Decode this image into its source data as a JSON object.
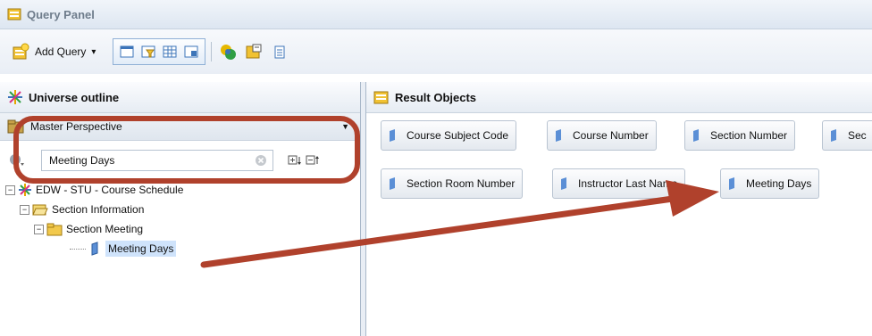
{
  "window": {
    "title": "Query Panel"
  },
  "toolbar": {
    "add_query_label": "Add Query",
    "add_query_arrow": "▾"
  },
  "universe_outline": {
    "title": "Universe outline",
    "perspective": "Master Perspective",
    "search_value": "Meeting Days",
    "tree": [
      {
        "label": "EDW - STU - Course Schedule",
        "icon": "universe-icon"
      },
      {
        "label": "Section Information",
        "icon": "folder-open-icon"
      },
      {
        "label": "Section Meeting",
        "icon": "folder-icon"
      },
      {
        "label": "Meeting Days",
        "icon": "dimension-icon"
      }
    ]
  },
  "result_objects": {
    "title": "Result Objects",
    "items": [
      {
        "label": "Course Subject Code"
      },
      {
        "label": "Course Number"
      },
      {
        "label": "Section Number"
      },
      {
        "label": "Sec"
      },
      {
        "label": "Section Room Number"
      },
      {
        "label": "Instructor Last Name"
      },
      {
        "label": "Meeting Days"
      }
    ]
  },
  "colors": {
    "annotation": "#b0412c",
    "accent": "#8fb0d6",
    "selection": "#cfe3fb"
  }
}
